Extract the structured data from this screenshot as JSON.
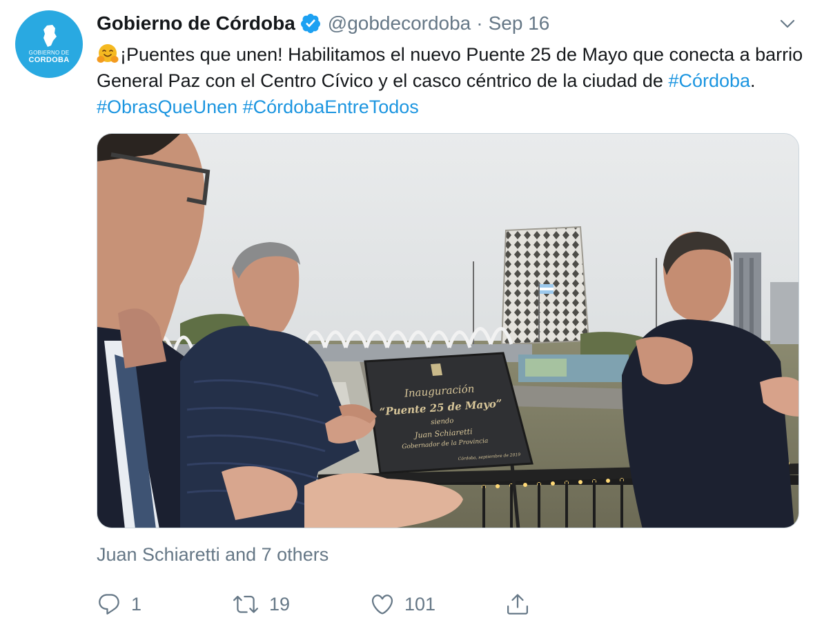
{
  "tweet": {
    "author": {
      "display_name": "Gobierno de Córdoba",
      "handle": "@gobdecordoba",
      "verified": true,
      "avatar_line1": "GOBIERNO DE",
      "avatar_line2": "CORDOBA",
      "avatar_color": "#29a9e1"
    },
    "separator": "·",
    "date": "Sep 16",
    "text": {
      "emoji": "hugging-face",
      "part1": "¡Puentes que unen! Habilitamos el nuevo Puente 25 de Mayo que conecta a barrio General Paz con el Centro Cívico y el casco céntrico de la ciudad de ",
      "hashtag1": "#Córdoba",
      "part2": ". ",
      "hashtag2": "#ObrasQueUnen",
      "space": " ",
      "hashtag3": "#CórdobaEntreTodos"
    },
    "media": {
      "plaque_line1": "Inauguración",
      "plaque_line2": "“Puente 25 de Mayo”",
      "plaque_line3": "siendo",
      "plaque_line4": "Juan Schiaretti",
      "plaque_line5": "Gobernador de la Provincia",
      "plaque_footer": "Córdoba, septiembre de 2019"
    },
    "tagged": "Juan Schiaretti and 7 others",
    "actions": {
      "reply_count": "1",
      "retweet_count": "19",
      "like_count": "101"
    }
  },
  "colors": {
    "link": "#1b95e0",
    "secondary_text": "#657786",
    "primary_text": "#14171a",
    "verified": "#1da1f2"
  },
  "icons": [
    "verified-badge-icon",
    "chevron-down-icon",
    "reply-icon",
    "retweet-icon",
    "like-icon",
    "share-icon",
    "hugging-face-emoji"
  ]
}
